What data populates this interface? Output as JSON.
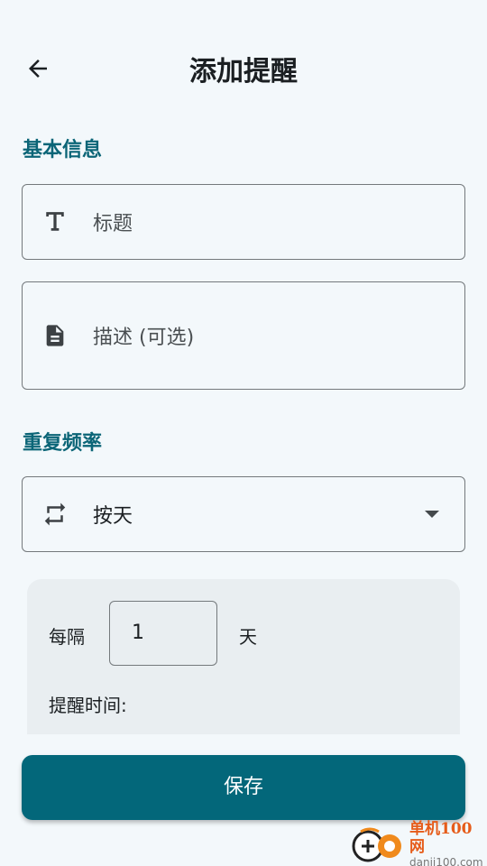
{
  "header": {
    "title": "添加提醒"
  },
  "basic_info": {
    "section_title": "基本信息",
    "title_field": {
      "placeholder": "标题",
      "icon": "text-title-icon"
    },
    "description_field": {
      "placeholder": "描述 (可选)",
      "icon": "document-icon"
    }
  },
  "repeat": {
    "section_title": "重复频率",
    "selected": "按天",
    "icon": "repeat-icon"
  },
  "interval": {
    "prefix": "每隔",
    "value": "1",
    "unit": "天",
    "time_label": "提醒时间:"
  },
  "save_label": "保存",
  "watermark": {
    "cn": "单机100网",
    "en": "danji100.com"
  },
  "colors": {
    "accent": "#03677a",
    "section_title": "#0b6577",
    "background": "#f3f8fb",
    "watermark": "#e65c1a"
  }
}
